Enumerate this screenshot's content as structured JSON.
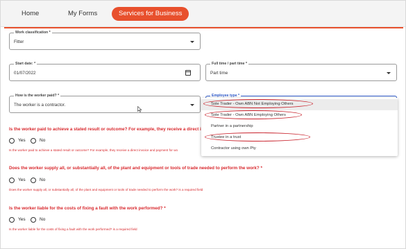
{
  "nav": {
    "tabs": [
      {
        "label": "Home",
        "active": false
      },
      {
        "label": "My Forms",
        "active": false
      },
      {
        "label": "Services for Business",
        "active": true
      }
    ]
  },
  "colors": {
    "accent": "#e8502d",
    "error": "#d8282d",
    "focus": "#2b57c8",
    "annotation": "#c8202a"
  },
  "form": {
    "work_classification": {
      "label": "Work classification *",
      "value": "Fitter"
    },
    "start_date": {
      "label": "Start date: *",
      "value": "01/07/2022"
    },
    "full_part_time": {
      "label": "Full time / part time *",
      "value": "Part time"
    },
    "payment": {
      "label": "How is the worker paid? *",
      "value": "The worker is a contractor."
    },
    "employee_type": {
      "label": "Employee type *",
      "options": [
        "Sole Trader - Own ABN Not Employing Others",
        "Sole Trader - Own ABN Employing Others",
        "Partner in a partnership",
        "Trustee in a trust",
        "Contractor using own Pty"
      ]
    },
    "questions": [
      {
        "text": "Is the worker paid to achieve a stated result or outcome? For example, they receive a direct invoi",
        "error": "Is the worker paid to achieve a stated result or outcome? For example, they receive a direct invoice and payment for wo",
        "yes": "Yes",
        "no": "No"
      },
      {
        "text": "Does the worker supply all, or substantially all, of the plant and equipment or tools of trade needed to perform the work? *",
        "error": "Does the worker supply all, or substantially all, of the plant and equipment or tools of trade needed to perform the work? is a required field",
        "yes": "Yes",
        "no": "No"
      },
      {
        "text": "Is the worker liable for the costs of fixing a fault with the work performed? *",
        "error": "Is the worker liable for the costs of fixing a fault with the work performed? is a required field",
        "yes": "Yes",
        "no": "No"
      }
    ]
  }
}
